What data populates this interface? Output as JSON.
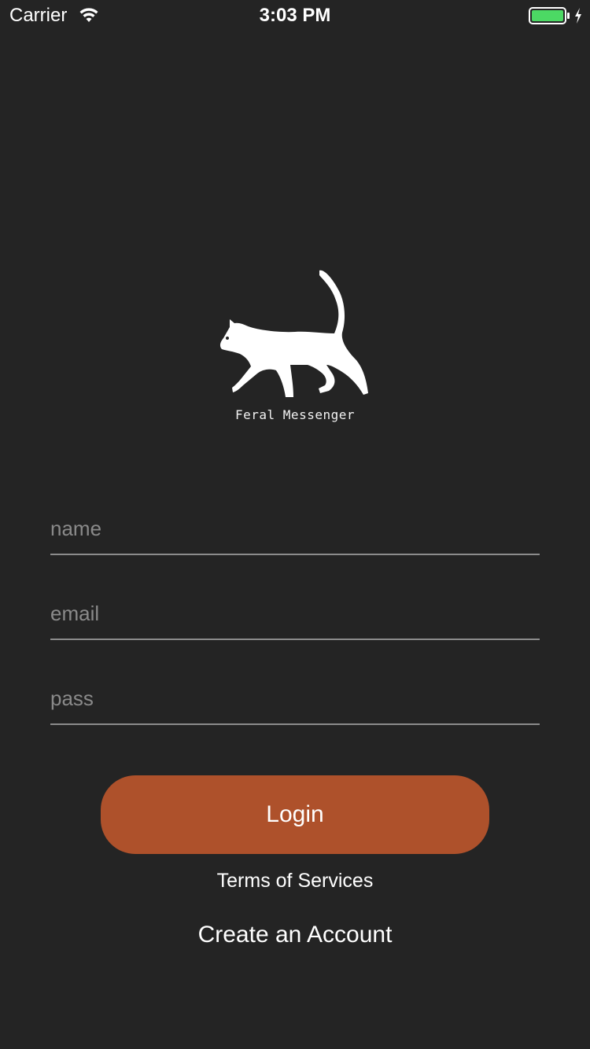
{
  "status_bar": {
    "carrier": "Carrier",
    "time": "3:03 PM",
    "wifi_icon": "wifi-icon",
    "battery_icon": "battery-charging-icon",
    "battery_color": "#4cd964"
  },
  "branding": {
    "logo_icon": "cat-icon",
    "app_name": "Feral Messenger"
  },
  "form": {
    "name_placeholder": "name",
    "email_placeholder": "email",
    "pass_placeholder": "pass",
    "name_value": "",
    "email_value": "",
    "pass_value": ""
  },
  "actions": {
    "login_label": "Login",
    "terms_label": "Terms of Services",
    "create_account_label": "Create an Account"
  },
  "colors": {
    "background": "#242424",
    "accent": "#ae512b"
  }
}
